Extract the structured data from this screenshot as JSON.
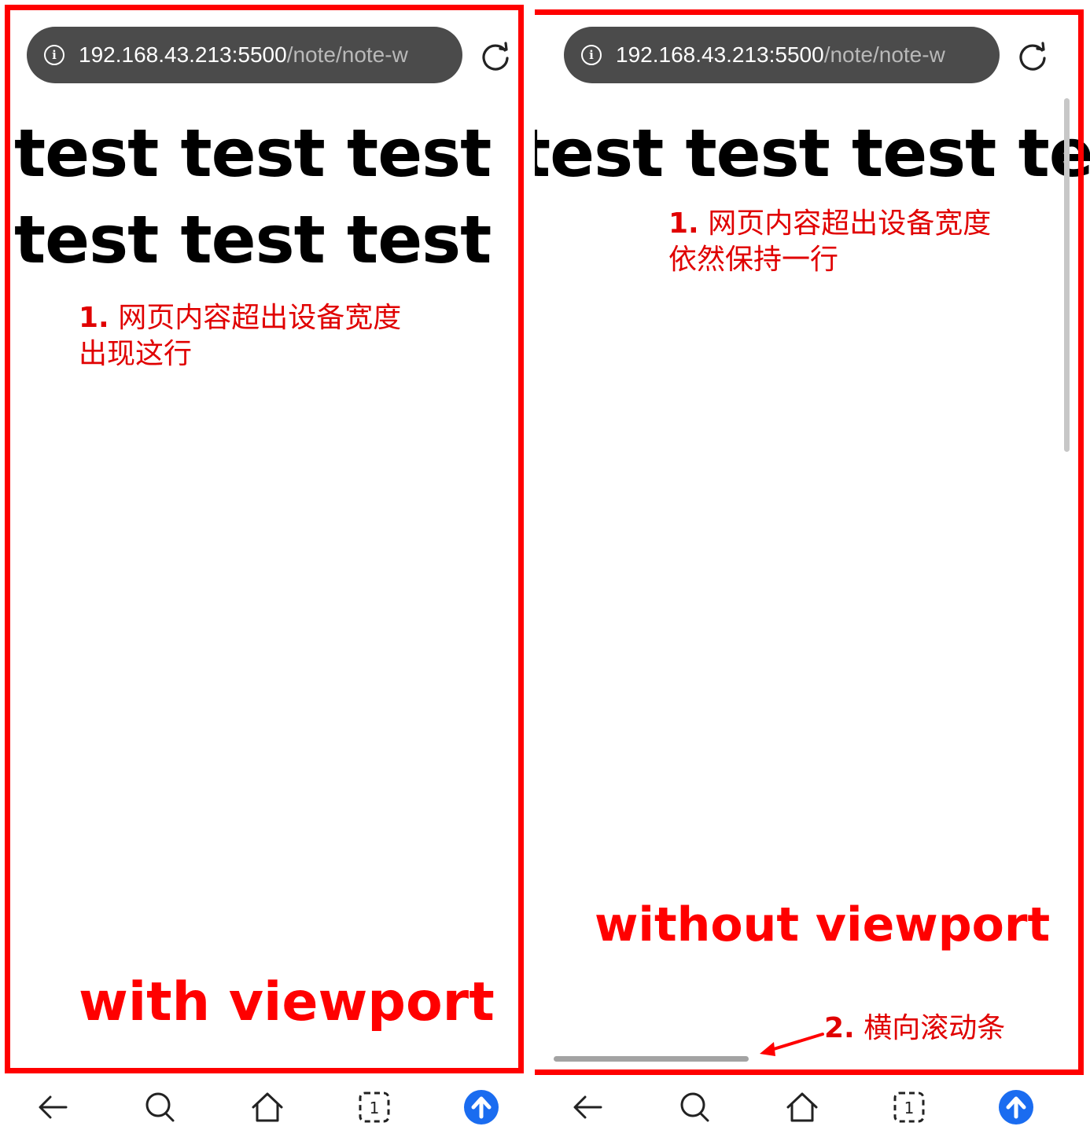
{
  "left": {
    "address": {
      "host": "192.168.43.213:5500",
      "path": "/note/note-w"
    },
    "content_lines": [
      "test test test",
      "test test test"
    ],
    "note": {
      "number": "1.",
      "line1": "网页内容超出设备宽度",
      "line2": "出现这行"
    },
    "caption": "with viewport"
  },
  "right": {
    "address": {
      "host": "192.168.43.213:5500",
      "path": "/note/note-w"
    },
    "content_line": "test test test test",
    "note": {
      "number": "1.",
      "line1": "网页内容超出设备宽度",
      "line2": "依然保持一行"
    },
    "caption": "without viewport",
    "scroll_note": {
      "number": "2.",
      "text": "横向滚动条"
    }
  },
  "bottom_nav": [
    "back-icon",
    "search-icon",
    "home-icon",
    "tabs-icon",
    "upload-icon"
  ],
  "tab_count": "1",
  "colors": {
    "annotation_red": "#ff0000",
    "address_bar": "#4b4b4b",
    "accent_blue": "#1a6cf0"
  }
}
